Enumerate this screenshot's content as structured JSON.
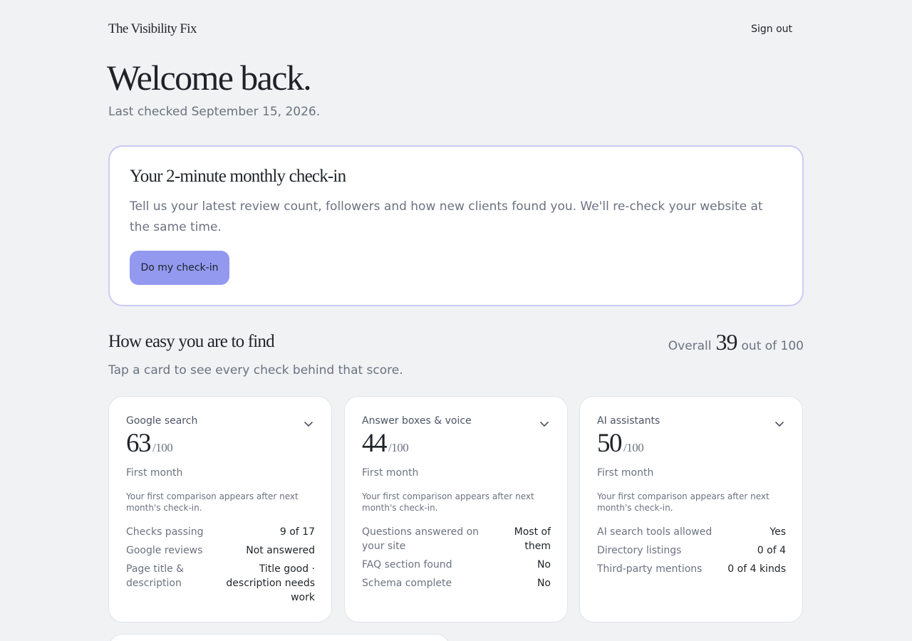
{
  "header": {
    "brand": "The Visibility Fix",
    "signout_label": "Sign out"
  },
  "welcome": {
    "title": "Welcome back.",
    "last_checked": "Last checked September 15, 2026."
  },
  "checkin": {
    "title": "Your 2-minute monthly check-in",
    "description": "Tell us your latest review count, followers and how new clients found you. We'll re-check your website at the same time.",
    "button_label": "Do my check-in"
  },
  "findability": {
    "title": "How easy you are to find",
    "subtitle": "Tap a card to see every check behind that score.",
    "overall_prefix": "Overall",
    "overall_score": "39",
    "overall_suffix": "out of 100"
  },
  "cards": [
    {
      "title": "Google search",
      "score": "63",
      "denom": "/100",
      "period": "First month",
      "note": "Your first comparison appears after next month's check-in.",
      "rows": [
        {
          "label": "Checks passing",
          "value": "9 of 17"
        },
        {
          "label": "Google reviews",
          "value": "Not answered"
        },
        {
          "label": "Page title & description",
          "value": "Title good · description needs work"
        }
      ]
    },
    {
      "title": "Answer boxes & voice",
      "score": "44",
      "denom": "/100",
      "period": "First month",
      "note": "Your first comparison appears after next month's check-in.",
      "rows": [
        {
          "label": "Questions answered on your site",
          "value": "Most of them"
        },
        {
          "label": "FAQ section found",
          "value": "No"
        },
        {
          "label": "Schema complete",
          "value": "No"
        }
      ]
    },
    {
      "title": "AI assistants",
      "score": "50",
      "denom": "/100",
      "period": "First month",
      "note": "Your first comparison appears after next month's check-in.",
      "rows": [
        {
          "label": "AI search tools allowed",
          "value": "Yes"
        },
        {
          "label": "Directory listings",
          "value": "0 of 4"
        },
        {
          "label": "Third-party mentions",
          "value": "0 of 4 kinds"
        }
      ]
    }
  ],
  "icons": {
    "expand": "chevron-down-icon"
  },
  "colors": {
    "background": "#f0f2f4",
    "accent_button": "#9299ef",
    "accent_border": "#c9cbf3",
    "muted_text": "#6b7280"
  }
}
